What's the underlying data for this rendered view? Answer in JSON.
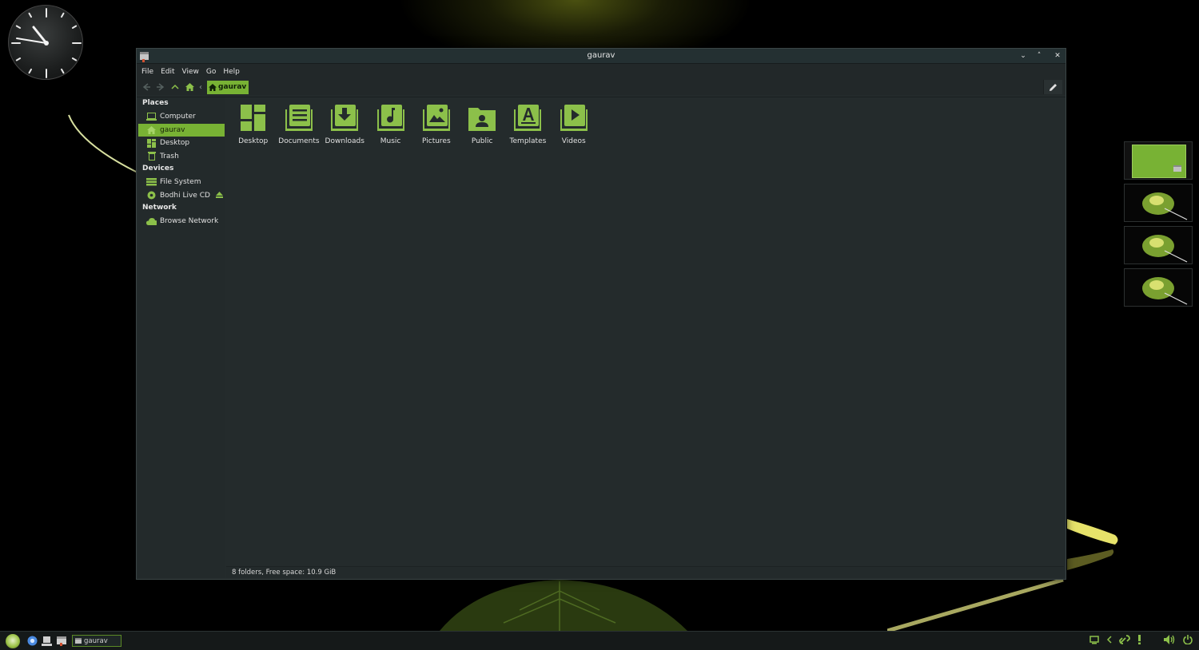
{
  "window": {
    "title": "gaurav",
    "controls": {
      "minimize": "⌄",
      "maximize": "˄",
      "close": "✕"
    }
  },
  "menu": [
    "File",
    "Edit",
    "View",
    "Go",
    "Help"
  ],
  "toolbar": {
    "back_icon": "arrow-left-icon",
    "forward_icon": "arrow-right-icon",
    "up_icon": "arrow-up-icon",
    "home_icon": "home-icon",
    "path_separator": "‹",
    "breadcrumb": "gaurav",
    "edit_icon": "pencil-icon"
  },
  "sidebar": {
    "places_header": "Places",
    "places": [
      {
        "label": "Computer",
        "icon": "computer-icon",
        "selected": false
      },
      {
        "label": "gaurav",
        "icon": "home-icon",
        "selected": true
      },
      {
        "label": "Desktop",
        "icon": "desktop-icon",
        "selected": false
      },
      {
        "label": "Trash",
        "icon": "trash-icon",
        "selected": false
      }
    ],
    "devices_header": "Devices",
    "devices": [
      {
        "label": "File System",
        "icon": "drive-icon"
      },
      {
        "label": "Bodhi Live CD",
        "icon": "cd-icon",
        "eject": true
      }
    ],
    "network_header": "Network",
    "network": [
      {
        "label": "Browse Network",
        "icon": "cloud-icon"
      }
    ]
  },
  "folders": [
    {
      "label": "Desktop",
      "icon": "desktop-folder-icon"
    },
    {
      "label": "Documents",
      "icon": "documents-folder-icon"
    },
    {
      "label": "Downloads",
      "icon": "downloads-folder-icon"
    },
    {
      "label": "Music",
      "icon": "music-folder-icon"
    },
    {
      "label": "Pictures",
      "icon": "pictures-folder-icon"
    },
    {
      "label": "Public",
      "icon": "public-folder-icon"
    },
    {
      "label": "Templates",
      "icon": "templates-folder-icon"
    },
    {
      "label": "Videos",
      "icon": "videos-folder-icon"
    }
  ],
  "status": "8 folders, Free space: 10.9 GiB",
  "taskbar": {
    "task_label": "gaurav",
    "launchers": [
      "chrome-icon",
      "file-manager-icon",
      "terminal-icon"
    ],
    "tray": [
      "display-icon",
      "chevron-left-icon",
      "network-link-icon",
      "alert-icon",
      "volume-icon",
      "power-icon"
    ]
  },
  "pager": {
    "workspaces": 4,
    "active": 1
  },
  "colors": {
    "accent": "#78b234",
    "window_bg": "#242b2c",
    "titlebar": "#243032"
  }
}
